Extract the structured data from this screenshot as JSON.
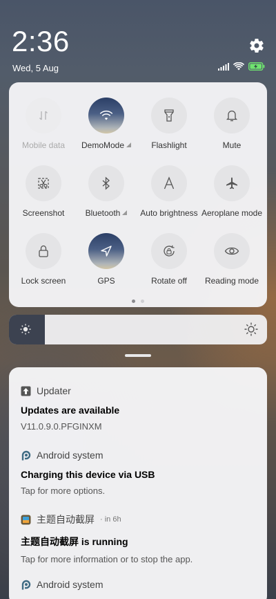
{
  "status": {
    "time": "2:36",
    "date": "Wed, 5 Aug"
  },
  "toggles": [
    {
      "label": "Mobile data",
      "icon": "mobile-data-icon",
      "state": "disabled"
    },
    {
      "label": "DemoMode",
      "icon": "wifi-icon",
      "state": "active",
      "has_submenu": true
    },
    {
      "label": "Flashlight",
      "icon": "flashlight-icon",
      "state": "off"
    },
    {
      "label": "Mute",
      "icon": "bell-icon",
      "state": "off"
    },
    {
      "label": "Screenshot",
      "icon": "scissors-icon",
      "state": "off"
    },
    {
      "label": "Bluetooth",
      "icon": "bluetooth-icon",
      "state": "off",
      "has_submenu": true
    },
    {
      "label": "Auto brightness",
      "icon": "auto-brightness-icon",
      "state": "off"
    },
    {
      "label": "Aeroplane mode",
      "icon": "airplane-icon",
      "state": "off"
    },
    {
      "label": "Lock screen",
      "icon": "lock-icon",
      "state": "off"
    },
    {
      "label": "GPS",
      "icon": "location-arrow-icon",
      "state": "active"
    },
    {
      "label": "Rotate off",
      "icon": "rotate-lock-icon",
      "state": "off"
    },
    {
      "label": "Reading mode",
      "icon": "eye-icon",
      "state": "off"
    }
  ],
  "pager": {
    "pages": 2,
    "current": 1
  },
  "brightness": {
    "level_fraction": 0.14
  },
  "notifications": [
    {
      "app": "Updater",
      "app_icon": "up-arrow-icon",
      "title": "Updates are available",
      "text": "V11.0.9.0.PFGINXM"
    },
    {
      "app": "Android system",
      "app_icon": "android-p-icon",
      "title": "Charging this device via USB",
      "text": "Tap for more options."
    },
    {
      "app": "主题自动截屏",
      "app_icon": "app-thumbnail-icon",
      "time": "· in 6h",
      "title": "主题自动截屏 is running",
      "text": "Tap for more information or to stop the app."
    },
    {
      "app": "Android system",
      "app_icon": "android-p-icon"
    }
  ],
  "colors": {
    "active_tile_top": "#2b3f66",
    "active_tile_bottom": "#d2c6a6",
    "panel_bg": "#f5f5f7"
  }
}
